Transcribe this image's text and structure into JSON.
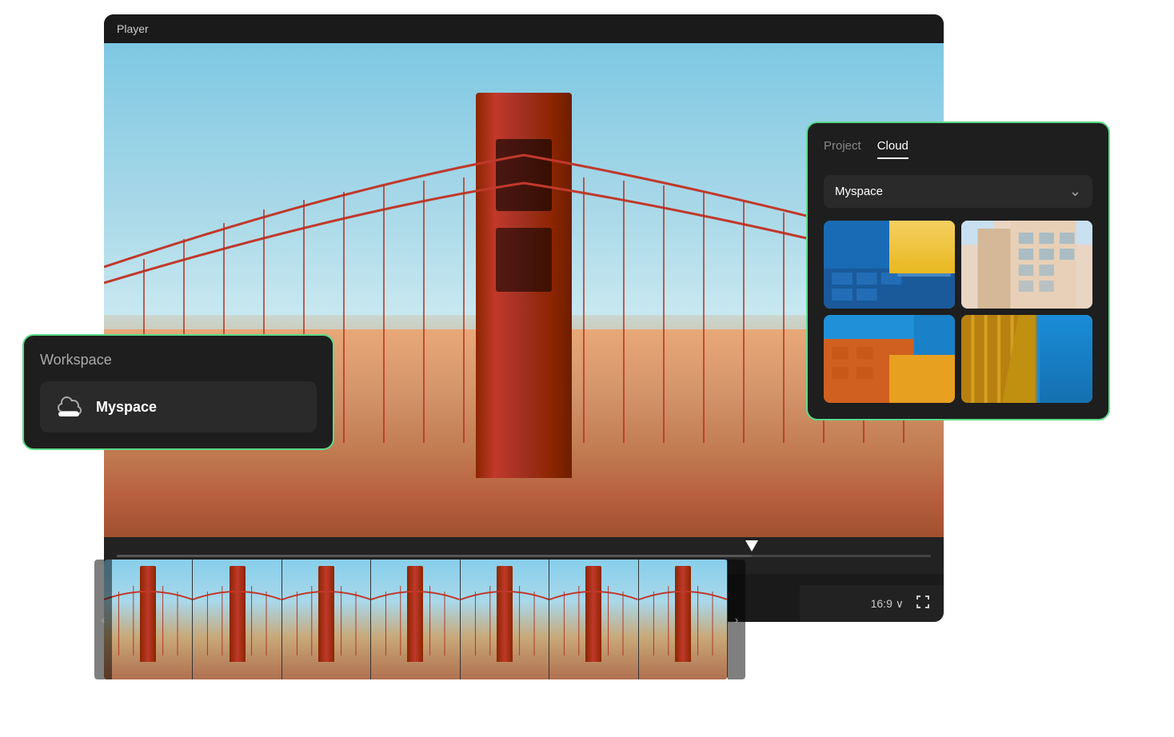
{
  "player": {
    "title": "Player",
    "aspect_ratio": "16:9",
    "aspect_ratio_label": "16:9 ∨",
    "fullscreen_label": "⛶"
  },
  "workspace_panel": {
    "title": "Workspace",
    "item": {
      "name": "Myspace",
      "icon": "cloud"
    }
  },
  "cloud_panel": {
    "tabs": [
      {
        "label": "Project",
        "active": false
      },
      {
        "label": "Cloud",
        "active": true
      }
    ],
    "dropdown": {
      "value": "Myspace",
      "placeholder": "Myspace"
    },
    "images": [
      {
        "id": 1,
        "alt": "Blue and yellow geometric building"
      },
      {
        "id": 2,
        "alt": "Cream/peach building facade"
      },
      {
        "id": 3,
        "alt": "Orange and yellow building"
      },
      {
        "id": 4,
        "alt": "Yellow column building"
      }
    ]
  },
  "filmstrip": {
    "frames": [
      1,
      2,
      3,
      4,
      5,
      6,
      7
    ]
  },
  "colors": {
    "green_border": "#5adb8a",
    "panel_bg": "#1e1e1e",
    "active_tab_color": "#ffffff"
  }
}
